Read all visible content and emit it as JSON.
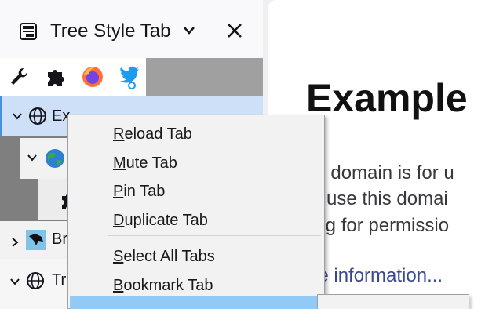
{
  "sidebar": {
    "title": "Tree Style Tab",
    "toolbar": [
      "wrench-icon",
      "puzzle-icon",
      "firefox-icon",
      "twitter-icon"
    ],
    "tabs": [
      {
        "label": "Example Domain",
        "visible_text": "Ex"
      },
      {
        "label": "",
        "visible_text": ""
      },
      {
        "label": "",
        "visible_text": ""
      },
      {
        "label": "Br",
        "visible_text": "Br"
      },
      {
        "label": "Tr",
        "visible_text": "Tr"
      }
    ]
  },
  "page": {
    "heading": "Example",
    "lines": [
      "his domain is for u",
      "ay use this domai",
      "king for permissio"
    ],
    "link": "ore information..."
  },
  "context_menu": {
    "items": [
      {
        "label": "Reload Tab",
        "accel": "R",
        "rest": "eload Tab"
      },
      {
        "label": "Mute Tab",
        "accel": "M",
        "rest": "ute Tab"
      },
      {
        "label": "Pin Tab",
        "accel": "P",
        "rest": "in Tab"
      },
      {
        "label": "Duplicate Tab",
        "accel": "D",
        "rest": "uplicate Tab"
      },
      {
        "label": "Select All Tabs",
        "accel": "S",
        "rest": "elect All Tabs"
      },
      {
        "label": "Bookmark Tab",
        "accel": "B",
        "rest": "ookmark Tab"
      }
    ]
  },
  "colors": {
    "accent": "#4a90d9",
    "selected_row": "#cde0f7",
    "menu_hover": "#91c9f7",
    "link": "#38488f"
  }
}
